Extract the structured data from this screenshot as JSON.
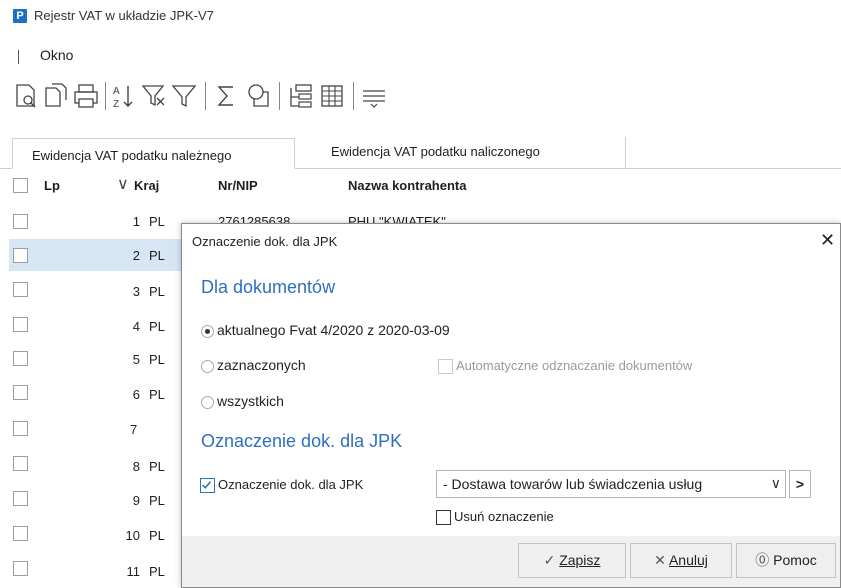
{
  "app": {
    "logo_letter": "P",
    "title": "Rejestr VAT w układzie JPK-V7"
  },
  "menu": {
    "items": [
      "Okno"
    ]
  },
  "toolbar": {
    "icons": [
      "preview-icon",
      "export-icon",
      "print-icon",
      "sort-icon",
      "filter-clear-icon",
      "filter-icon",
      "sum-icon",
      "column-settings-icon",
      "group-icon",
      "grid-icon",
      "more-icon"
    ]
  },
  "tabs": [
    {
      "label": "Ewidencja VAT podatku należnego",
      "active": true
    },
    {
      "label": "Ewidencja VAT podatku naliczonego",
      "active": false
    }
  ],
  "grid": {
    "headers": {
      "lp": "Lp",
      "kraj": "Kraj",
      "nip": "Nr/NIP",
      "name": "Nazwa kontrahenta"
    },
    "first_row_nip": "2761285638",
    "first_row_name": "PHU \"KWIATEK\"",
    "rows": [
      {
        "lp": "1",
        "kraj": "PL"
      },
      {
        "lp": "2",
        "kraj": "PL",
        "selected": true
      },
      {
        "lp": "3",
        "kraj": "PL"
      },
      {
        "lp": "4",
        "kraj": "PL"
      },
      {
        "lp": "5",
        "kraj": "PL"
      },
      {
        "lp": "6",
        "kraj": "PL"
      },
      {
        "lp": "7",
        "kraj": ""
      },
      {
        "lp": "8",
        "kraj": "PL"
      },
      {
        "lp": "9",
        "kraj": "PL"
      },
      {
        "lp": "10",
        "kraj": "PL"
      },
      {
        "lp": "11",
        "kraj": "PL"
      }
    ]
  },
  "dialog": {
    "title": "Oznaczenie dok. dla JPK",
    "close": "✕",
    "section1": "Dla dokumentów",
    "radio_current": "aktualnego Fvat 4/2020 z 2020-03-09",
    "radio_selected": "zaznaczonych",
    "radio_all": "wszystkich",
    "auto_unmark": "Automatyczne odznaczanie dokumentów",
    "section2": "Oznaczenie dok. dla JPK",
    "mark_checkbox": "Oznaczenie dok. dla JPK",
    "mark_value": "- Dostawa towarów lub świadczenia usług",
    "remove_mark": "Usuń oznaczenie",
    "btn_save": "Zapisz",
    "btn_cancel": "Anuluj",
    "btn_help": "Pomoc"
  },
  "colors": {
    "accent": "#2f6fbf",
    "selection": "#d6e6f5"
  }
}
